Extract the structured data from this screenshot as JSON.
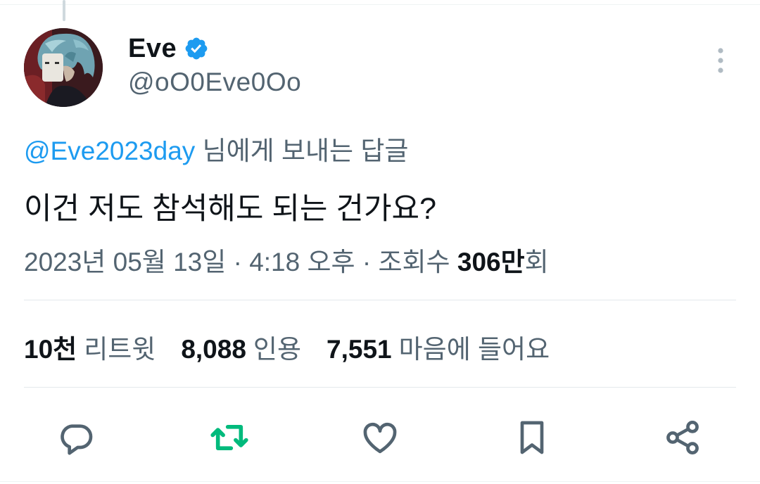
{
  "author": {
    "display_name": "Eve",
    "handle": "@oO0Eve0Oo",
    "verified": true,
    "avatar": "anime-avatar-blue-hair"
  },
  "reply_to": {
    "mention": "@Eve2023day",
    "suffix": " 님에게 보내는 답글"
  },
  "tweet": {
    "text": "이건 저도 참석해도 되는 건가요?"
  },
  "meta": {
    "date": "2023년 05월 13일",
    "separator1": " · ",
    "time": "4:18 오후",
    "separator2": " · ",
    "views_label": "조회수 ",
    "views_count": "306만",
    "views_suffix": "회"
  },
  "stats": {
    "retweets_count": "10천",
    "retweets_label": "리트윗",
    "quotes_count": "8,088",
    "quotes_label": "인용",
    "likes_count": "7,551",
    "likes_label": "마음에 들어요"
  },
  "actions": [
    {
      "icon": "reply-icon"
    },
    {
      "icon": "retweet-icon"
    },
    {
      "icon": "like-icon"
    },
    {
      "icon": "bookmark-icon"
    },
    {
      "icon": "share-icon"
    }
  ],
  "colors": {
    "link": "#1d9bf0",
    "retweet": "#00ba7c",
    "muted": "#536471",
    "icon": "#536471",
    "text": "#0f1419"
  }
}
